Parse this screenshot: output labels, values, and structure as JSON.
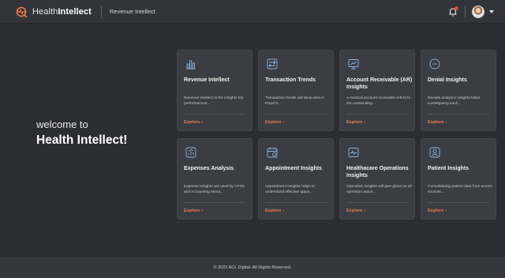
{
  "topbar": {
    "brand_prefix": "Health",
    "brand_bold": "Intellect",
    "module_title": "Revenue Intellect",
    "notification_icon": "bell-icon",
    "avatar_icon": "user-avatar",
    "menu_icon": "chevron-down-icon"
  },
  "welcome": {
    "line1": "welcome to",
    "line2": "Health Intellect!"
  },
  "cards": [
    {
      "title": "Revenue Intellect",
      "description": "Revenue Intellect is the insights top performances...",
      "cta": "Explore  ›",
      "icon": "bar-chart-icon"
    },
    {
      "title": "Transaction Trends",
      "description": "Transaction trends will deep-dive in Payer's...",
      "cta": "Explore  ›",
      "icon": "transaction-icon"
    },
    {
      "title": "Account Receivable (AR) Insights",
      "description": "A medical account receivable refers to the outstanding...",
      "cta": "Explore  ›",
      "icon": "presentation-icon"
    },
    {
      "title": "Denial Insights",
      "description": "Denials analytics insights helps investigating each...",
      "cta": "Explore  ›",
      "icon": "minus-circle-icon"
    },
    {
      "title": "Expenses Analysis",
      "description": "Expense Insights are used by CFOs and Accounting Mana...",
      "cta": "Explore  ›",
      "icon": "expense-chart-icon"
    },
    {
      "title": "Appointment Insights",
      "description": "Appointment Insights helps to understand effective appoi...",
      "cta": "Explore  ›",
      "icon": "calendar-icon"
    },
    {
      "title": "Healthacare Operations Insights",
      "description": "Operation Insights will give glace on all operation aroun...",
      "cta": "Explore  ›",
      "icon": "heartbeat-monitor-icon"
    },
    {
      "title": "Patient Insights",
      "description": "Consolidating patient data from across sources...",
      "cta": "Explore  ›",
      "icon": "patient-id-icon"
    }
  ],
  "footer": {
    "copyright": "© 2022 ACL Digital. All Rights Reserved."
  },
  "colors": {
    "background": "#2b2d32",
    "card": "#3a3d43",
    "accent": "#f07a4a",
    "notification_dot": "#e2433d"
  }
}
